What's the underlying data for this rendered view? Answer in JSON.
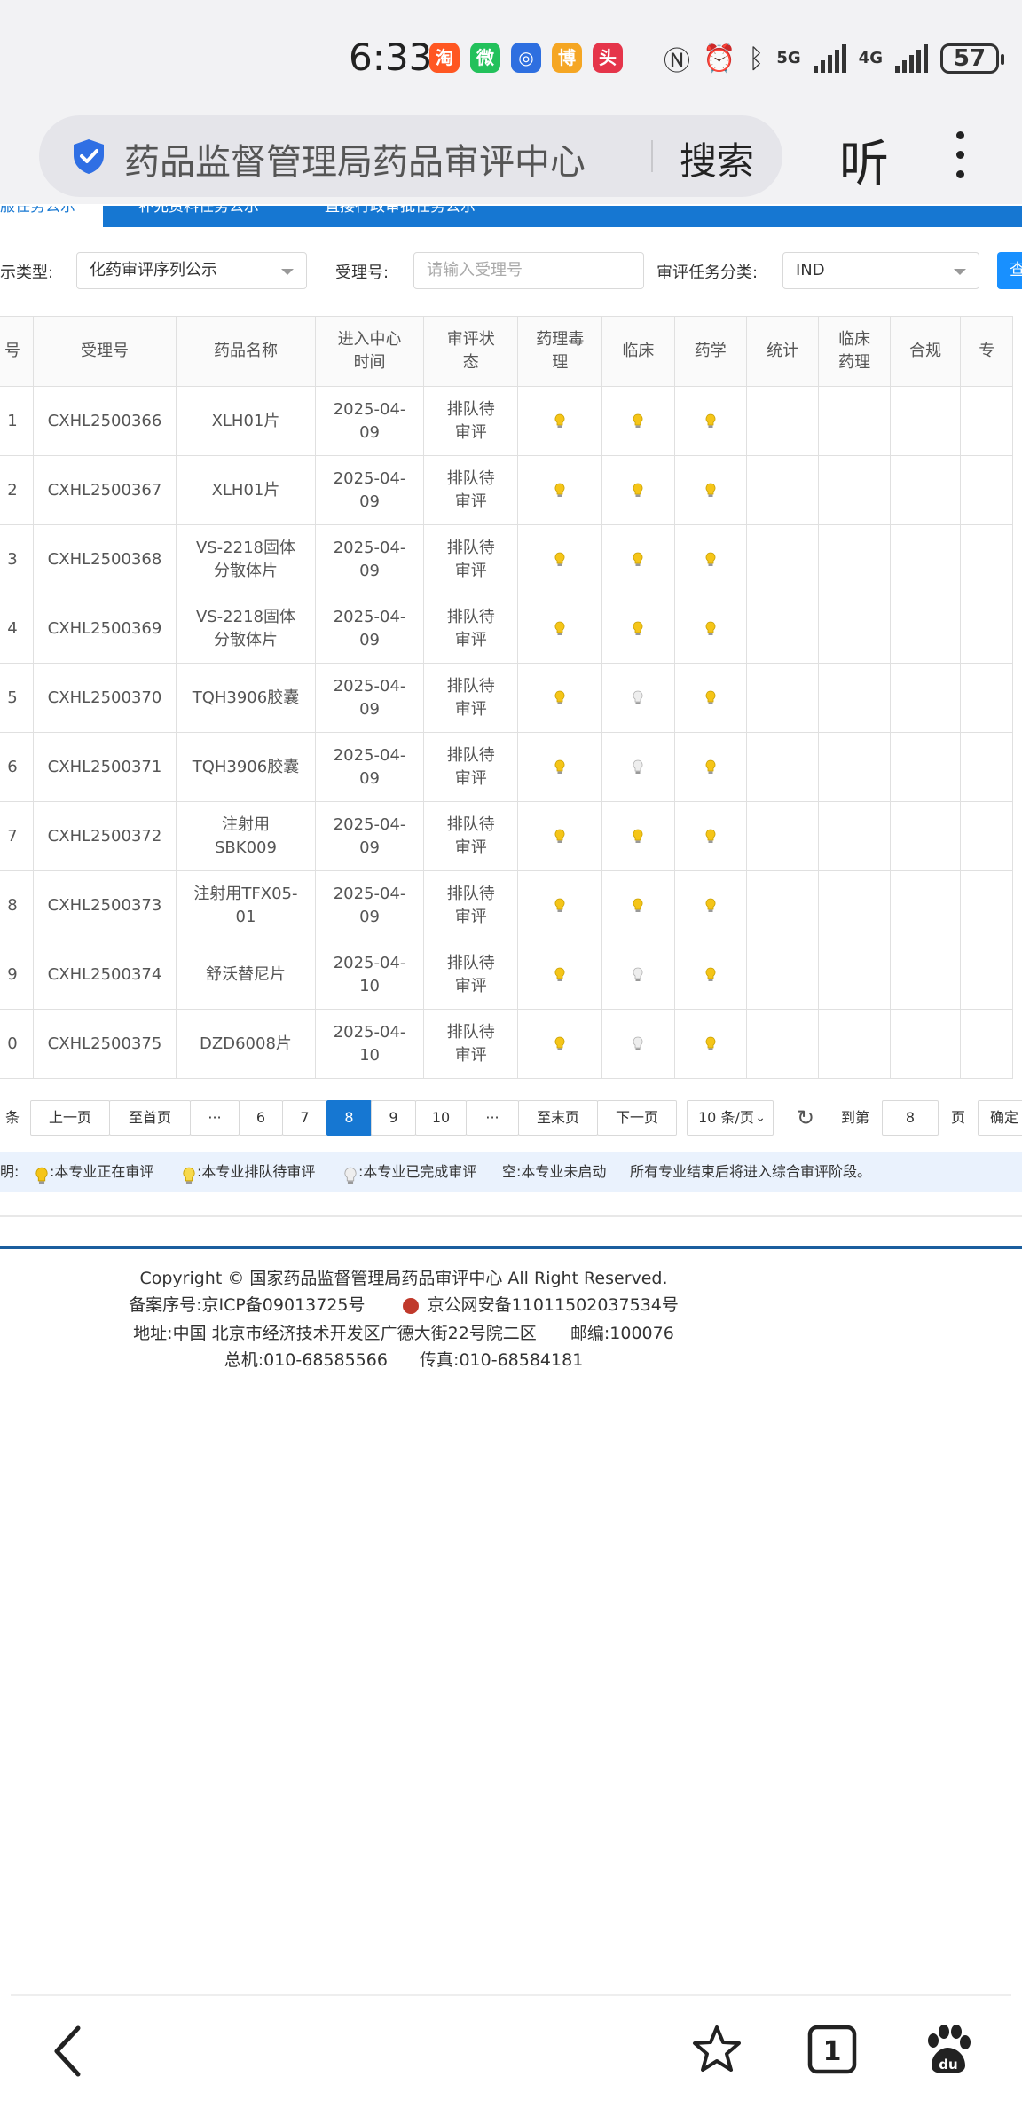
{
  "status_bar": {
    "time": "6:33",
    "network_5g": "5G",
    "network_4g": "4G",
    "battery": "57",
    "apps": [
      {
        "name": "taobao-app-icon",
        "color": "#ff5722",
        "glyph": "淘"
      },
      {
        "name": "wechat-app-icon",
        "color": "#23c15b",
        "glyph": "微"
      },
      {
        "name": "blue-app-icon",
        "color": "#2e6fe0",
        "glyph": "◎"
      },
      {
        "name": "weibo-app-icon",
        "color": "#f5a623",
        "glyph": "博"
      },
      {
        "name": "red-app-icon",
        "color": "#e5354a",
        "glyph": "头"
      }
    ]
  },
  "browser": {
    "search_text": "药品监督管理局药品审评中心",
    "search_button": "搜索",
    "listen_button": "听"
  },
  "tabs": {
    "active": "服任务公示",
    "tab2": "补充资料任务公示",
    "tab3": "直接行政审批任务公示"
  },
  "filters": {
    "display_type_label": "示类型:",
    "display_type_value": "化药审评序列公示",
    "acceptance_no_label": "受理号:",
    "acceptance_no_placeholder": "请输入受理号",
    "task_category_label": "审评任务分类:",
    "task_category_value": "IND",
    "query_button": "查"
  },
  "table": {
    "headers": [
      "号",
      "受理号",
      "药品名称",
      "进入中心时间",
      "审评状态",
      "药理毒理",
      "临床",
      "药学",
      "统计",
      "临床药理",
      "合规",
      "专"
    ],
    "header_lines": [
      [
        "号"
      ],
      [
        "受理号"
      ],
      [
        "药品名称"
      ],
      [
        "进入中心",
        "时间"
      ],
      [
        "审评状",
        "态"
      ],
      [
        "药理毒",
        "理"
      ],
      [
        "临床"
      ],
      [
        "药学"
      ],
      [
        "统计"
      ],
      [
        "临床",
        "药理"
      ],
      [
        "合规"
      ],
      [
        "专"
      ]
    ],
    "rows": [
      {
        "no": "1",
        "acceptance_no": "CXHL2500366",
        "drug_name": "XLH01片",
        "date_line1": "2025-04-",
        "date_line2": "09",
        "status_line1": "排队待",
        "status_line2": "审评",
        "pharm_tox": "queued",
        "clinical": "queued",
        "cmc": "queued"
      },
      {
        "no": "2",
        "acceptance_no": "CXHL2500367",
        "drug_name": "XLH01片",
        "date_line1": "2025-04-",
        "date_line2": "09",
        "status_line1": "排队待",
        "status_line2": "审评",
        "pharm_tox": "queued",
        "clinical": "queued",
        "cmc": "queued"
      },
      {
        "no": "3",
        "acceptance_no": "CXHL2500368",
        "drug_name": "VS-2218固体分散体片",
        "drug_line1": "VS-2218固体",
        "drug_line2": "分散体片",
        "date_line1": "2025-04-",
        "date_line2": "09",
        "status_line1": "排队待",
        "status_line2": "审评",
        "pharm_tox": "queued",
        "clinical": "queued",
        "cmc": "queued"
      },
      {
        "no": "4",
        "acceptance_no": "CXHL2500369",
        "drug_name": "VS-2218固体分散体片",
        "drug_line1": "VS-2218固体",
        "drug_line2": "分散体片",
        "date_line1": "2025-04-",
        "date_line2": "09",
        "status_line1": "排队待",
        "status_line2": "审评",
        "pharm_tox": "queued",
        "clinical": "queued",
        "cmc": "queued"
      },
      {
        "no": "5",
        "acceptance_no": "CXHL2500370",
        "drug_name": "TQH3906胶囊",
        "date_line1": "2025-04-",
        "date_line2": "09",
        "status_line1": "排队待",
        "status_line2": "审评",
        "pharm_tox": "queued",
        "clinical": "done",
        "cmc": "queued"
      },
      {
        "no": "6",
        "acceptance_no": "CXHL2500371",
        "drug_name": "TQH3906胶囊",
        "date_line1": "2025-04-",
        "date_line2": "09",
        "status_line1": "排队待",
        "status_line2": "审评",
        "pharm_tox": "queued",
        "clinical": "done",
        "cmc": "queued"
      },
      {
        "no": "7",
        "acceptance_no": "CXHL2500372",
        "drug_name": "注射用SBK009",
        "drug_line1": "注射用",
        "drug_line2": "SBK009",
        "date_line1": "2025-04-",
        "date_line2": "09",
        "status_line1": "排队待",
        "status_line2": "审评",
        "pharm_tox": "queued",
        "clinical": "queued",
        "cmc": "queued"
      },
      {
        "no": "8",
        "acceptance_no": "CXHL2500373",
        "drug_name": "注射用TFX05-01",
        "drug_line1": "注射用TFX05-",
        "drug_line2": "01",
        "date_line1": "2025-04-",
        "date_line2": "09",
        "status_line1": "排队待",
        "status_line2": "审评",
        "pharm_tox": "queued",
        "clinical": "queued",
        "cmc": "queued"
      },
      {
        "no": "9",
        "acceptance_no": "CXHL2500374",
        "drug_name": "舒沃替尼片",
        "date_line1": "2025-04-",
        "date_line2": "10",
        "status_line1": "排队待",
        "status_line2": "审评",
        "pharm_tox": "queued",
        "clinical": "done",
        "cmc": "queued"
      },
      {
        "no": "0",
        "acceptance_no": "CXHL2500375",
        "drug_name": "DZD6008片",
        "date_line1": "2025-04-",
        "date_line2": "10",
        "status_line1": "排队待",
        "status_line2": "审评",
        "pharm_tox": "queued",
        "clinical": "done",
        "cmc": "queued"
      }
    ]
  },
  "pagination": {
    "count_suffix": "条",
    "prev": "上一页",
    "first": "至首页",
    "ellipsis1": "···",
    "p6": "6",
    "p7": "7",
    "current": "8",
    "p9": "9",
    "p10": "10",
    "ellipsis2": "···",
    "last": "至末页",
    "next": "下一页",
    "page_size": "10 条/页",
    "goto_label": "到第",
    "goto_value": "8",
    "page_unit": "页",
    "confirm": "确定"
  },
  "legend": {
    "prefix": "明:",
    "in_review": ":本专业正在审评",
    "queued": ":本专业排队待审评",
    "done": ":本专业已完成审评",
    "not_started": "空:本专业未启动",
    "note": "所有专业结束后将进入综合审评阶段。"
  },
  "colors": {
    "bulb_on": "#f5c518",
    "bulb_off": "#dddddd",
    "primary": "#1677d2"
  },
  "footer": {
    "copyright": "Copyright © 国家药品监督管理局药品审评中心   All Right Reserved.",
    "icp": "备案序号:京ICP备09013725号",
    "police": "京公网安备11011502037534号",
    "address": "地址:中国 北京市经济技术开发区广德大街22号院二区",
    "postcode": "邮编:100076",
    "phone": "总机:010-68585566",
    "fax": "传真:010-68584181"
  }
}
